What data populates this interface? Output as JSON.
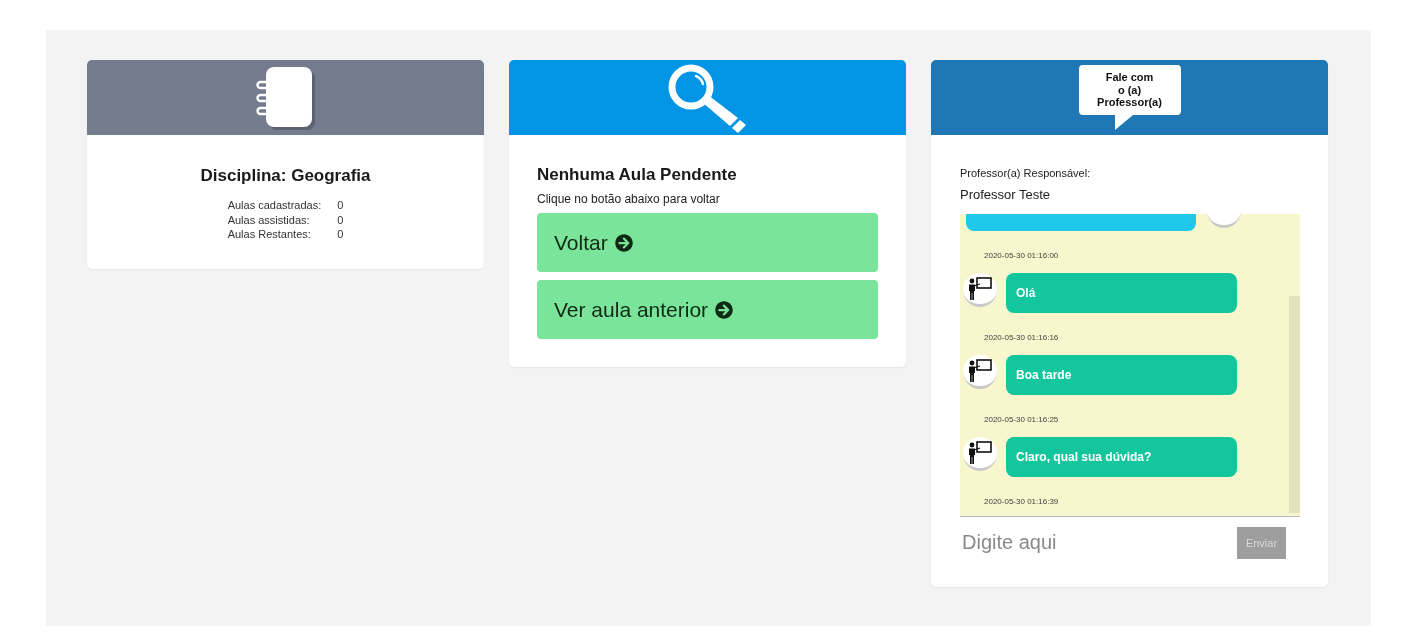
{
  "subject_card": {
    "title": "Disciplina: Geografia",
    "stats": [
      {
        "label": "Aulas cadastradas:",
        "value": "0"
      },
      {
        "label": "Aulas assistidas:",
        "value": "0"
      },
      {
        "label": "Aulas Restantes:",
        "value": "0"
      }
    ]
  },
  "lesson_card": {
    "title": "Nenhuma Aula Pendente",
    "subtitle": "Clique no botão abaixo para voltar",
    "buttons": [
      "Voltar",
      "Ver aula anterior"
    ]
  },
  "chat_card": {
    "badge_lines": [
      "Fale com",
      "o (a)",
      "Professor(a)"
    ],
    "teacher_label": "Professor(a) Responsável:",
    "teacher_name": "Professor Teste",
    "messages": [
      {
        "kind": "sent",
        "time": "2020-05-30 01:16:00"
      },
      {
        "kind": "received",
        "text": "Olá",
        "time": "2020-05-30 01:16:16"
      },
      {
        "kind": "received",
        "text": "Boa tarde",
        "time": "2020-05-30 01:16:25"
      },
      {
        "kind": "received",
        "text": "Claro, qual sua dúvida?",
        "time": "2020-05-30 01:16:39"
      }
    ],
    "input": {
      "placeholder": "Digite aqui"
    },
    "send_button": {
      "label": "Enviar",
      "disabled": true
    }
  }
}
